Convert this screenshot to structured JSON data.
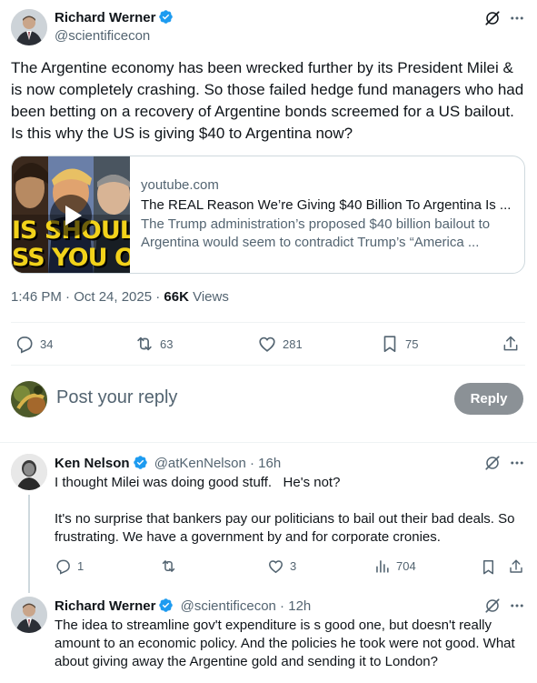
{
  "main_tweet": {
    "author_name": "Richard Werner",
    "author_handle": "@scientificecon",
    "text": "The Argentine economy has been wrecked further by its President Milei & is now completely crashing. So those failed hedge fund managers who had been betting on a recovery of Argentine bonds screemed for a US bailout. Is this why the US is giving $40 to Argentina now?",
    "card": {
      "thumb_text_line1": "IS SHOUL",
      "thumb_text_line2": "SS YOU OF",
      "domain": "youtube.com",
      "title": "The REAL Reason We’re Giving $40 Billion To Argentina Is ...",
      "description": "The Trump administration’s proposed $40 billion bailout to Argentina would seem to contradict Trump’s “America ..."
    },
    "time": "1:46 PM · Oct 24, 2025 · ",
    "views_count": "66K",
    "views_label": " Views",
    "stats": {
      "replies": "34",
      "reposts": "63",
      "likes": "281",
      "bookmarks": "75"
    }
  },
  "compose": {
    "placeholder": "Post your reply",
    "button_label": "Reply"
  },
  "replies": [
    {
      "author_name": "Ken Nelson",
      "author_handle": "@atKenNelson",
      "time": " · 16h",
      "line1": "I thought Milei was doing good stuff.   He's not?",
      "line2": "It's no surprise that bankers pay our politicians to bail out their bad deals. So frustrating.  We have a government by and for corporate cronies.",
      "stats": {
        "replies": "1",
        "reposts": "",
        "likes": "3",
        "views": "704"
      }
    },
    {
      "author_name": "Richard Werner",
      "author_handle": "@scientificecon",
      "time": " · 12h",
      "text": "The idea to streamline gov't expenditure is s good one, but doesn't really amount to an economic policy. And the policies he took were not good. What about giving away the Argentine gold and sending it to London?"
    }
  ],
  "colors": {
    "verified": "#1d9bf0",
    "text": "#0f1419",
    "muted": "#536471",
    "reply_button": "#8b9196"
  }
}
